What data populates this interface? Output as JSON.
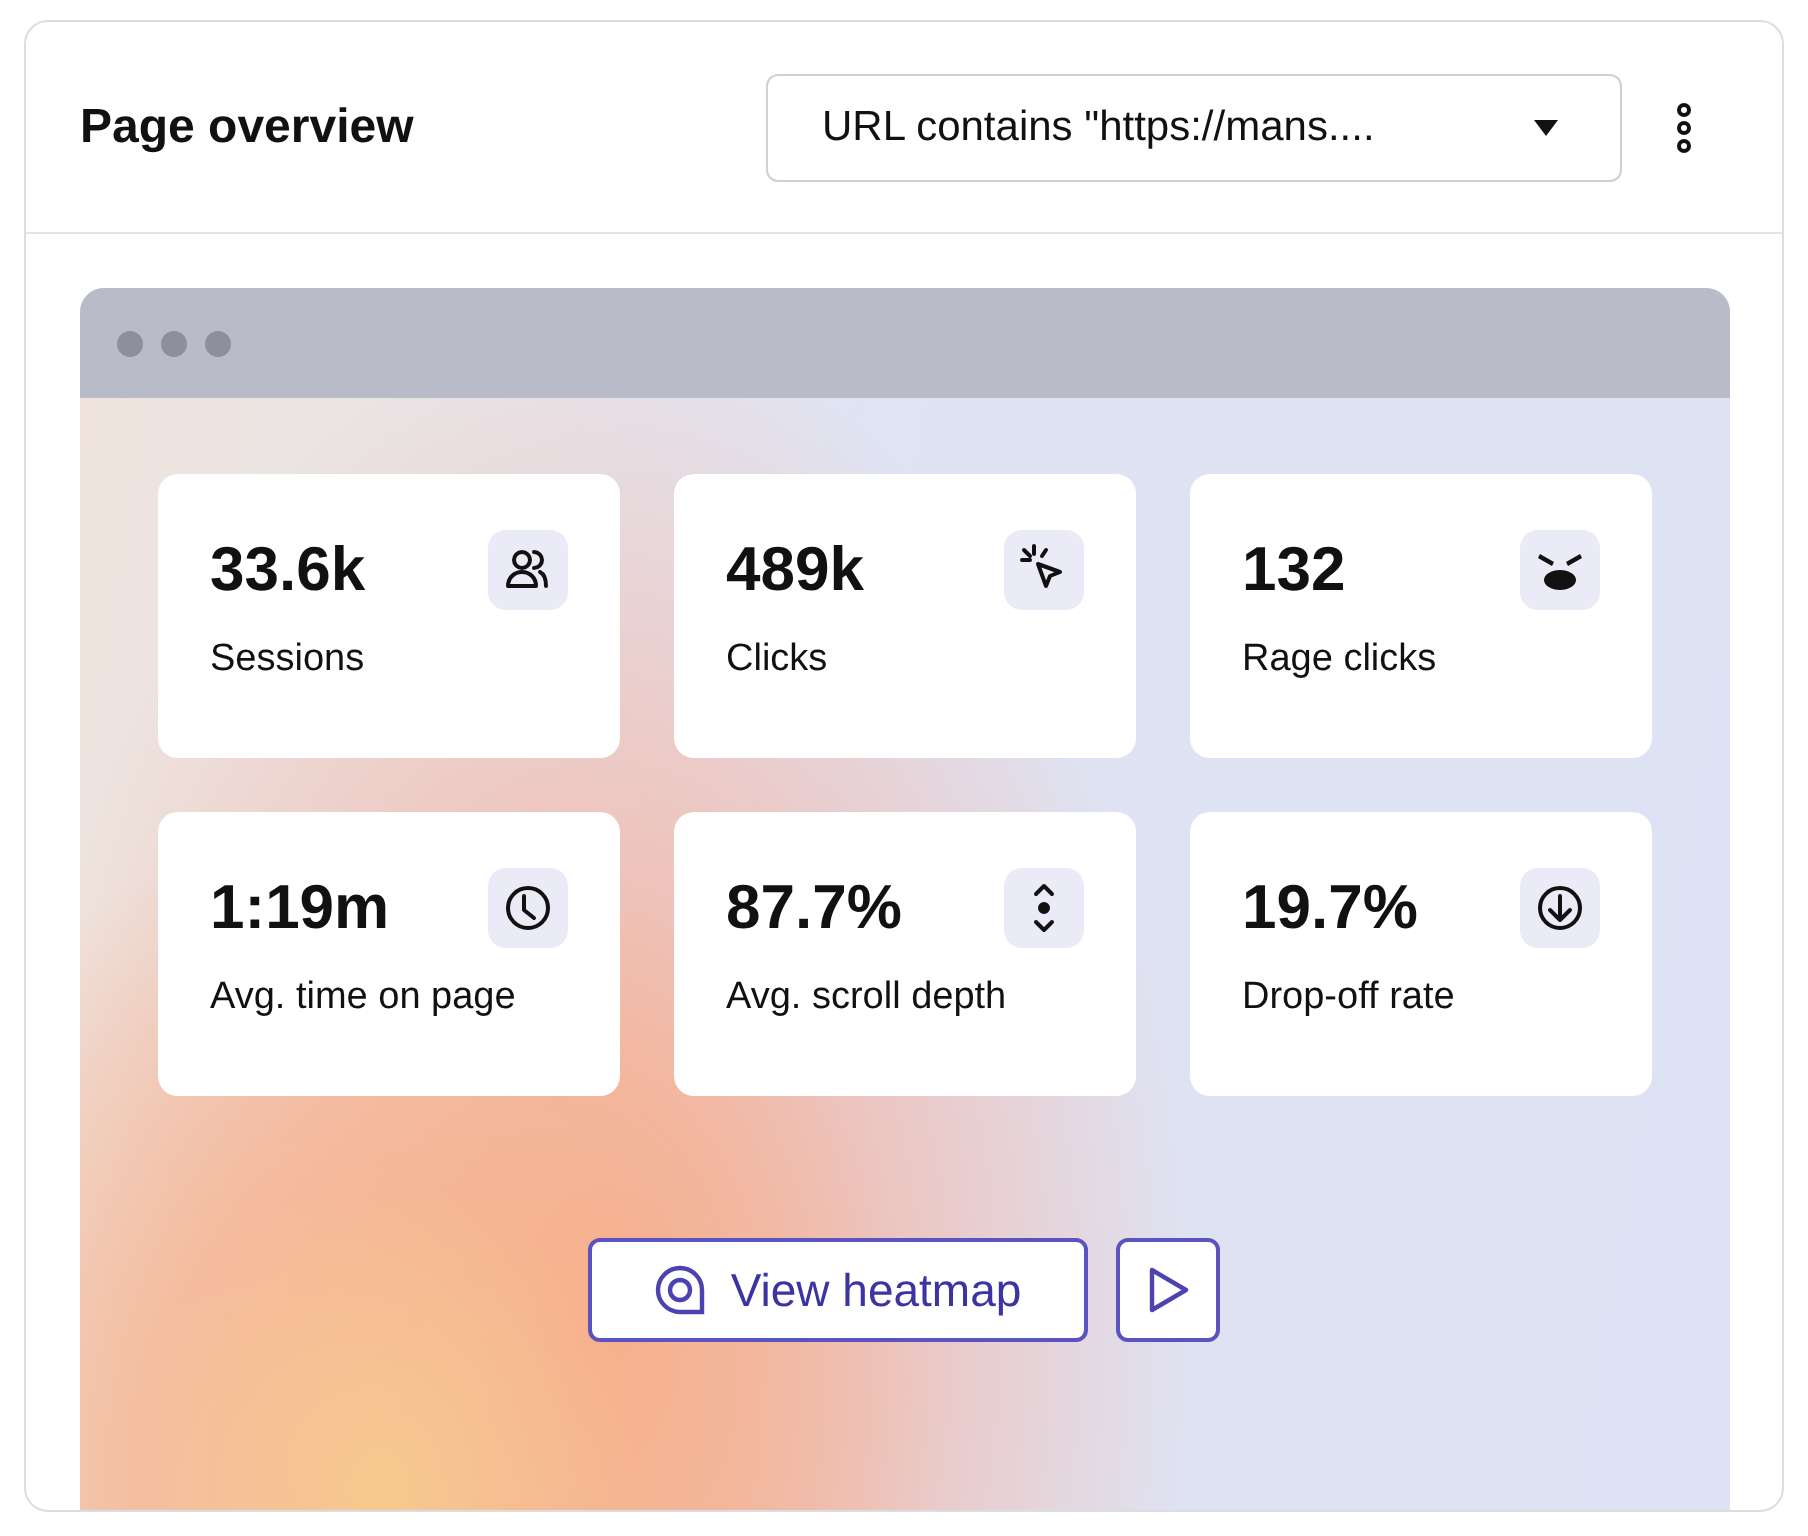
{
  "card": {
    "title": "Page overview",
    "filter": {
      "value": "URL contains \"https://mans...."
    }
  },
  "stats": [
    {
      "value": "33.6k",
      "label": "Sessions",
      "kind": "people"
    },
    {
      "value": "489k",
      "label": "Clicks",
      "kind": "click"
    },
    {
      "value": "132",
      "label": "Rage clicks",
      "kind": "angry"
    },
    {
      "value": "1:19m",
      "label": "Avg. time on page",
      "kind": "clock"
    },
    {
      "value": "87.7%",
      "label": "Avg. scroll depth",
      "kind": "scroll"
    },
    {
      "value": "19.7%",
      "label": "Drop-off rate",
      "kind": "down"
    }
  ],
  "actions": {
    "heatmap": "View heatmap"
  }
}
